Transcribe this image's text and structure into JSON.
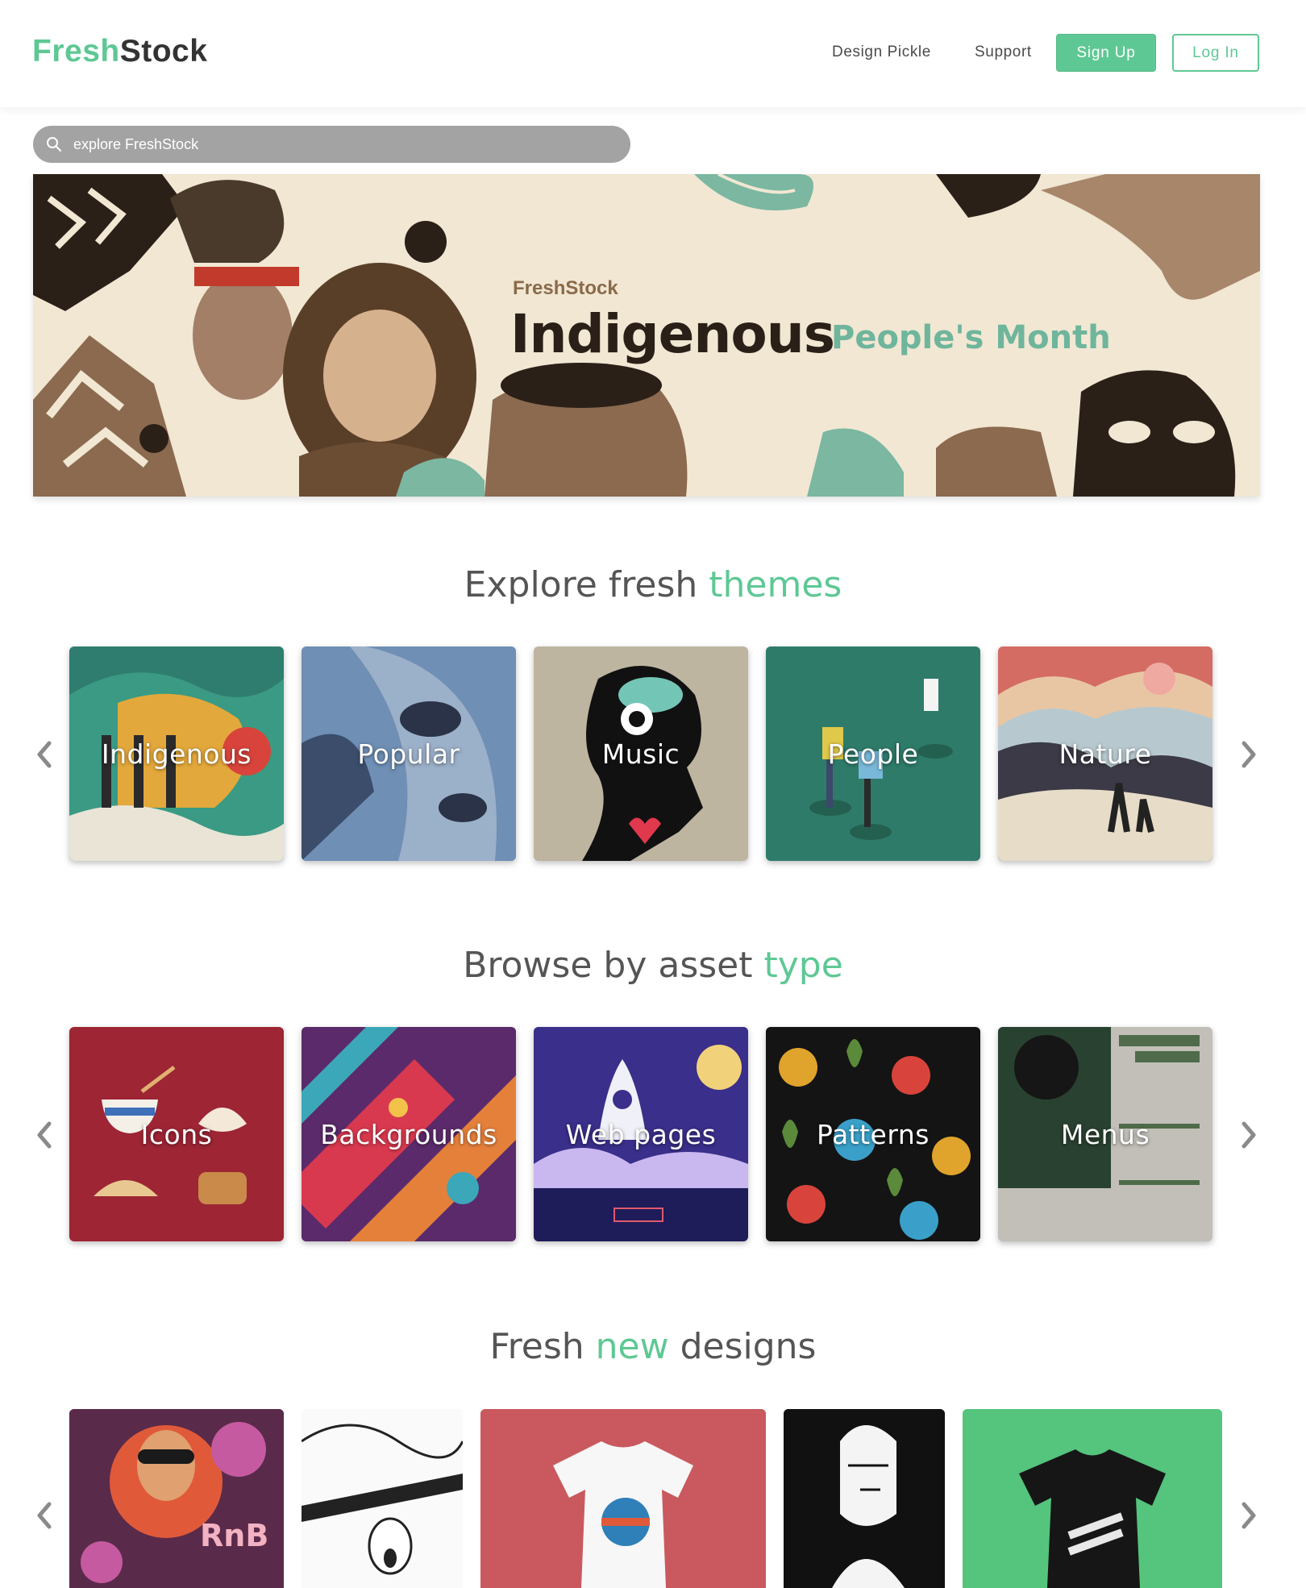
{
  "header": {
    "logo_part1": "Fresh",
    "logo_part2": "Stock",
    "nav": [
      "Design Pickle",
      "Support"
    ],
    "signup_label": "Sign Up",
    "login_label": "Log In"
  },
  "search": {
    "placeholder": "explore FreshStock",
    "icon": "search-icon"
  },
  "hero": {
    "brand": "FreshStock",
    "title": "Indigenous",
    "subtitle": "People's Month"
  },
  "themes": {
    "title_part1": "Explore fresh ",
    "title_highlight": "themes",
    "items": [
      "Indigenous",
      "Popular",
      "Music",
      "People",
      "Nature"
    ]
  },
  "asset_types": {
    "title_part1": "Browse by asset ",
    "title_highlight": "type",
    "items": [
      "Icons",
      "Backgrounds",
      "Web pages",
      "Patterns",
      "Menus"
    ]
  },
  "new_designs": {
    "title_part1": "Fresh ",
    "title_highlight": "new",
    "title_part2": " designs",
    "poster_text": "RnB"
  },
  "colors": {
    "brand_green": "#5ec894",
    "text_gray": "#4a4a4a",
    "search_bg": "#a3a3a3"
  }
}
